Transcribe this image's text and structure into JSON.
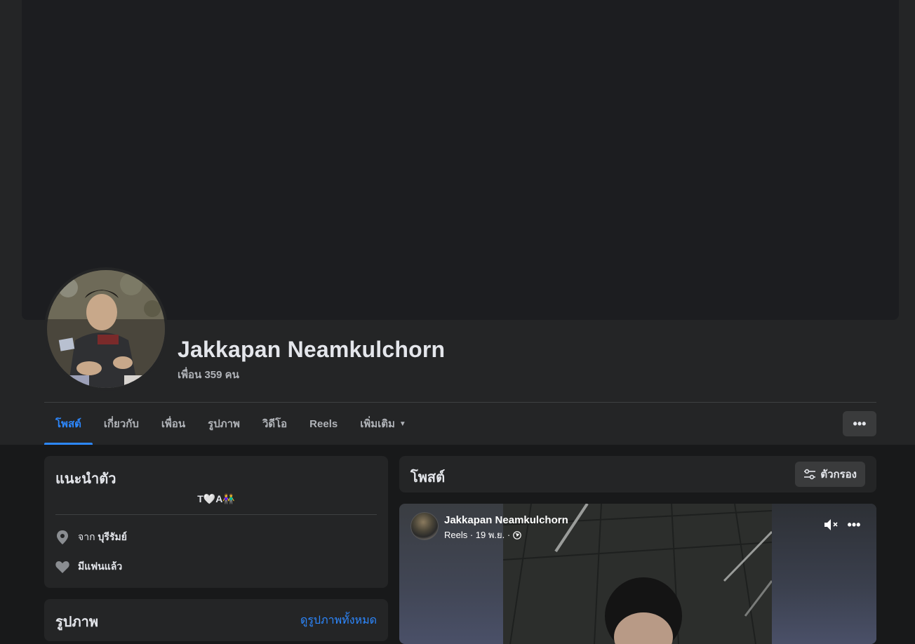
{
  "profile": {
    "name": "Jakkapan Neamkulchorn",
    "friends": "เพื่อน 359 คน"
  },
  "tabs": [
    {
      "label": "โพสต์",
      "active": true
    },
    {
      "label": "เกี่ยวกับ"
    },
    {
      "label": "เพื่อน"
    },
    {
      "label": "รูปภาพ"
    },
    {
      "label": "วิดีโอ"
    },
    {
      "label": "Reels"
    },
    {
      "label": "เพิ่มเติม",
      "has_dropdown": true
    }
  ],
  "more_button": "•••",
  "intro": {
    "title": "แนะนำตัว",
    "bio": "T🤍A👫",
    "location_prefix": "จาก",
    "location": "บุรีรัมย์",
    "relationship": "มีแฟนแล้ว"
  },
  "photos": {
    "title": "รูปภาพ",
    "see_all": "ดูรูปภาพทั้งหมด"
  },
  "posts": {
    "title": "โพสต์",
    "filter_label": "ตัวกรอง"
  },
  "reel_post": {
    "author": "Jakkapan Neamkulchorn",
    "meta": "Reels · 19 พ.ย. ·",
    "more": "•••"
  },
  "colors": {
    "accent": "#2d88ff",
    "card": "#242526",
    "background": "#18191a"
  }
}
